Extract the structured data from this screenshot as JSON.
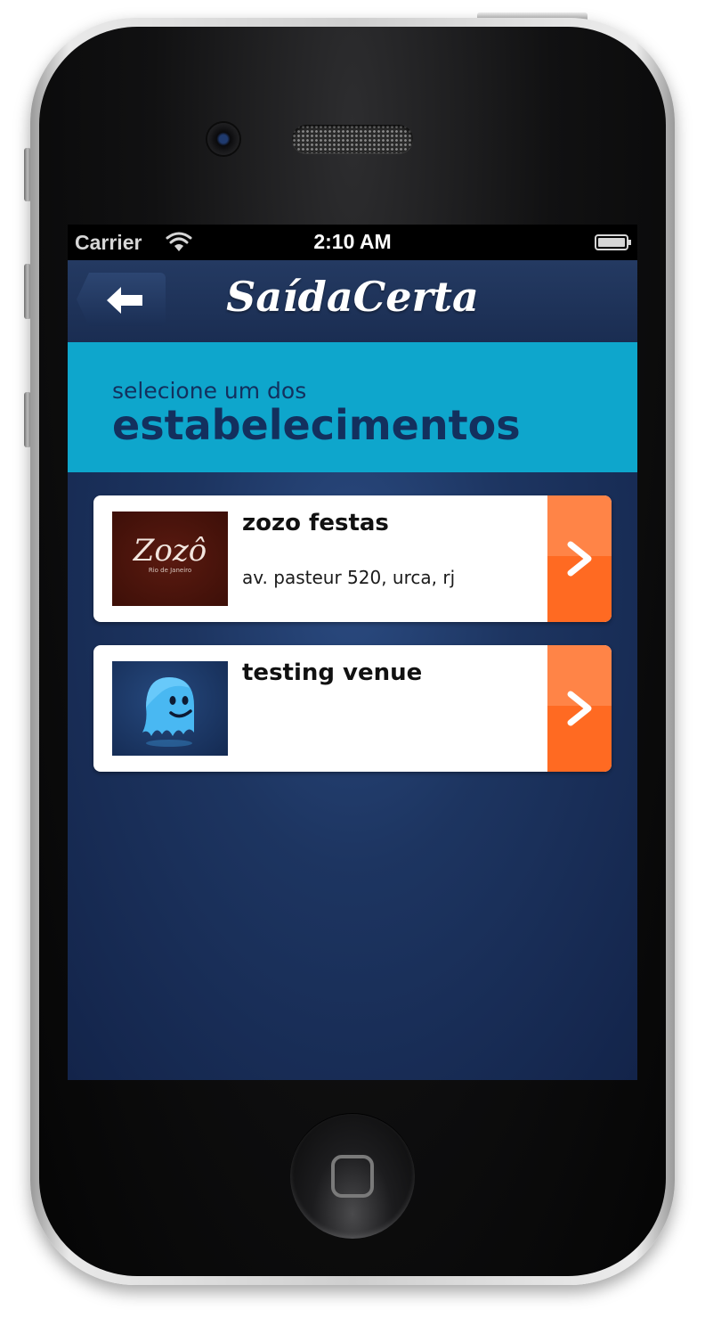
{
  "status_bar": {
    "carrier": "Carrier",
    "time": "2:10 AM"
  },
  "nav": {
    "logo": "SaídaCerta",
    "back_icon": "back-arrow-icon"
  },
  "header": {
    "subtitle": "selecione um dos",
    "title": "estabelecimentos",
    "background_color": "#0ea6cc",
    "text_color": "#13305e"
  },
  "venues": [
    {
      "name": "zozo festas",
      "address": "av. pasteur 520, urca, rj",
      "thumb_logo_text": "Zozô",
      "thumb_logo_subtext": "Rio de Janeiro"
    },
    {
      "name": "testing venue",
      "address": "",
      "thumb_icon": "ghost-icon"
    }
  ],
  "colors": {
    "action_orange": "#ff6a22",
    "nav_navy": "#1a2d52"
  }
}
